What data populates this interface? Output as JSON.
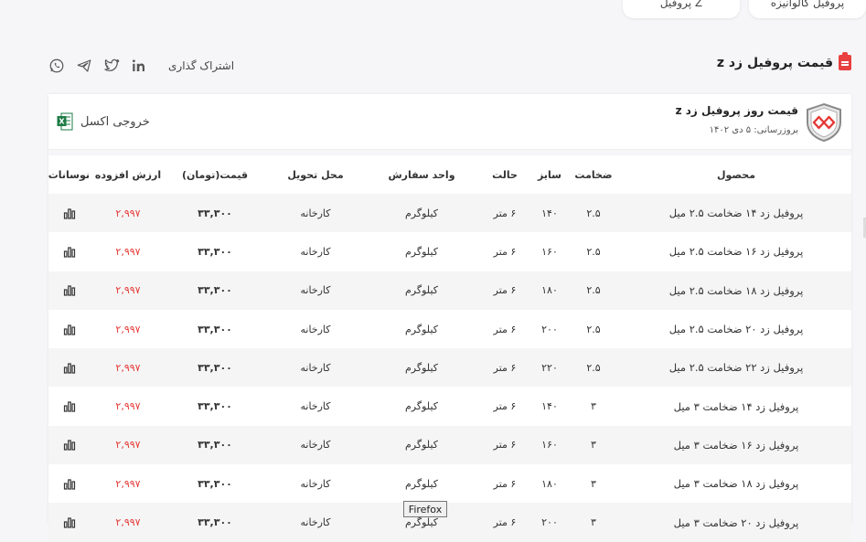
{
  "tabs": [
    {
      "label": "پروفیل گالوانیزه"
    },
    {
      "label": "پروفیل Z"
    }
  ],
  "page_title": "قیمت پروفیل زد z",
  "share": {
    "label": "اشتراک گذاری",
    "icons": [
      "linkedin-icon",
      "twitter-icon",
      "telegram-icon",
      "whatsapp-icon"
    ]
  },
  "card": {
    "title": "قیمت روز پروفیل زد z",
    "updated": "بروزرسانی: ۵ دی ۱۴۰۲",
    "excel_label": "خروجی اکسل"
  },
  "table": {
    "headers": [
      "محصول",
      "ضخامت",
      "سایز",
      "حالت",
      "واحد سفارش",
      "محل تحویل",
      "قیمت(تومان)",
      "ارزش افزوده",
      "نوسانات"
    ],
    "rows": [
      {
        "product": "پروفیل زد ۱۴ ضخامت ۲.۵ میل",
        "thickness": "۲.۵",
        "size": "۱۴۰",
        "state": "۶ متر",
        "unit": "کیلوگرم",
        "delivery": "کارخانه",
        "price": "۳۳,۳۰۰",
        "vat": "۲,۹۹۷"
      },
      {
        "product": "پروفیل زد ۱۶ ضخامت ۲.۵ میل",
        "thickness": "۲.۵",
        "size": "۱۶۰",
        "state": "۶ متر",
        "unit": "کیلوگرم",
        "delivery": "کارخانه",
        "price": "۳۳,۳۰۰",
        "vat": "۲,۹۹۷"
      },
      {
        "product": "پروفیل زد ۱۸ ضخامت ۲.۵ میل",
        "thickness": "۲.۵",
        "size": "۱۸۰",
        "state": "۶ متر",
        "unit": "کیلوگرم",
        "delivery": "کارخانه",
        "price": "۳۳,۳۰۰",
        "vat": "۲,۹۹۷"
      },
      {
        "product": "پروفیل زد ۲۰ ضخامت ۲.۵ میل",
        "thickness": "۲.۵",
        "size": "۲۰۰",
        "state": "۶ متر",
        "unit": "کیلوگرم",
        "delivery": "کارخانه",
        "price": "۳۳,۳۰۰",
        "vat": "۲,۹۹۷"
      },
      {
        "product": "پروفیل زد ۲۲ ضخامت ۲.۵ میل",
        "thickness": "۲.۵",
        "size": "۲۲۰",
        "state": "۶ متر",
        "unit": "کیلوگرم",
        "delivery": "کارخانه",
        "price": "۳۳,۳۰۰",
        "vat": "۲,۹۹۷"
      },
      {
        "product": "پروفیل زد ۱۴ ضخامت ۳ میل",
        "thickness": "۳",
        "size": "۱۴۰",
        "state": "۶ متر",
        "unit": "کیلوگرم",
        "delivery": "کارخانه",
        "price": "۳۳,۳۰۰",
        "vat": "۲,۹۹۷"
      },
      {
        "product": "پروفیل زد ۱۶ ضخامت ۳ میل",
        "thickness": "۳",
        "size": "۱۶۰",
        "state": "۶ متر",
        "unit": "کیلوگرم",
        "delivery": "کارخانه",
        "price": "۳۳,۳۰۰",
        "vat": "۲,۹۹۷"
      },
      {
        "product": "پروفیل زد ۱۸ ضخامت ۳ میل",
        "thickness": "۳",
        "size": "۱۸۰",
        "state": "۶ متر",
        "unit": "کیلوگرم",
        "delivery": "کارخانه",
        "price": "۳۳,۳۰۰",
        "vat": "۲,۹۹۷"
      },
      {
        "product": "پروفیل زد ۲۰ ضخامت ۳ میل",
        "thickness": "۳",
        "size": "۲۰۰",
        "state": "۶ متر",
        "unit": "کیلوگرم",
        "delivery": "کارخانه",
        "price": "۳۳,۳۰۰",
        "vat": "۲,۹۹۷"
      }
    ]
  },
  "tooltip": "Firefox",
  "colors": {
    "accent": "#e94040",
    "vat": "#e53935"
  }
}
